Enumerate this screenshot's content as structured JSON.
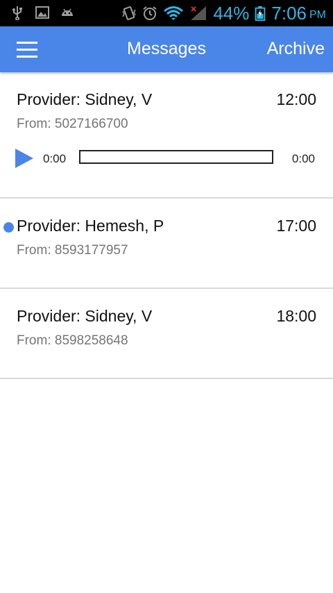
{
  "status_bar": {
    "battery_percent": "44%",
    "time": "7:06",
    "ampm": "PM",
    "icons": [
      "usb-icon",
      "image-icon",
      "android-icon",
      "vibrate-icon",
      "alarm-icon",
      "wifi-icon",
      "signal-icon",
      "battery-icon"
    ]
  },
  "app_bar": {
    "title": "Messages",
    "archive_label": "Archive",
    "color": "#4a86e8"
  },
  "messages": [
    {
      "provider": "Provider: Sidney, V",
      "time": "12:00",
      "from": "From: 5027166700",
      "unread": false,
      "player": {
        "current": "0:00",
        "duration": "0:00",
        "progress": 0
      }
    },
    {
      "provider": "Provider: Hemesh, P",
      "time": "17:00",
      "from": "From: 8593177957",
      "unread": true
    },
    {
      "provider": "Provider: Sidney, V",
      "time": "18:00",
      "from": "From: 8598258648",
      "unread": false
    }
  ]
}
